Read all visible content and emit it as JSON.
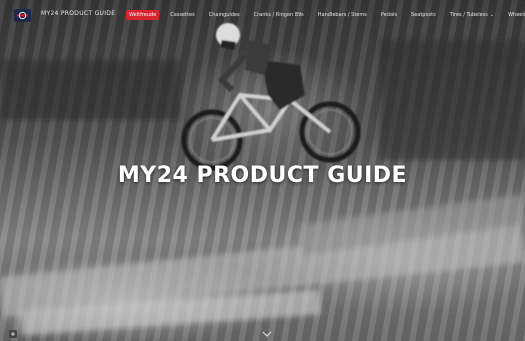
{
  "header": {
    "brand": "MY24 PRODUCT GUIDE",
    "menu": [
      {
        "label": "Weltfreude",
        "active": true
      },
      {
        "label": "Cassettes",
        "active": false
      },
      {
        "label": "Chainguides",
        "active": false
      },
      {
        "label": "Cranks / Ringen 89s",
        "active": false
      },
      {
        "label": "Handlebars / Stems",
        "active": false
      },
      {
        "label": "Pedals",
        "active": false
      },
      {
        "label": "Seatposts",
        "active": false
      },
      {
        "label": "Tires / Tubeless",
        "active": false,
        "dropdown": true
      },
      {
        "label": "Wheels / Rims / Hubs",
        "active": false
      }
    ]
  },
  "hero": {
    "title": "MY24 PRODUCT GUIDE"
  },
  "colors": {
    "accent": "#d9232e",
    "text": "#ffffff"
  },
  "icons": {
    "logo": "brand-logo-icon",
    "scroll": "chevron-down-icon",
    "corner": "settings-icon"
  }
}
